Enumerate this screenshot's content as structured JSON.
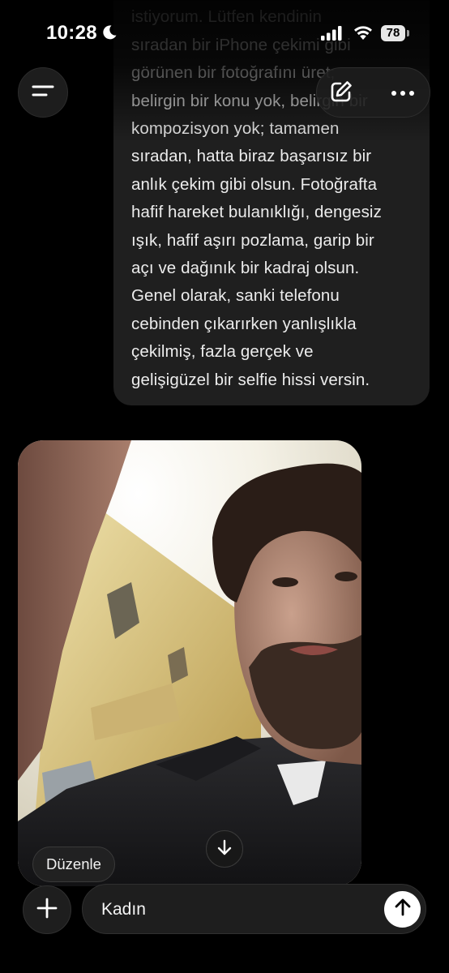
{
  "status_bar": {
    "time": "10:28",
    "battery": "78",
    "icons": [
      "moon-icon",
      "signal-icon",
      "wifi-icon",
      "battery-icon"
    ]
  },
  "header": {
    "menu_icon": "hamburger-menu-icon",
    "new_chat_icon": "compose-icon",
    "more_icon": "more-dots-icon"
  },
  "message": {
    "lines": [
      "istiyorum. Lütfen kendinin",
      "sıradan bir iPhone çekimi gibi",
      "görünen bir fotoğrafını üret;",
      "belirgin bir konu yok, belirgin bir",
      "kompozisyon yok; tamamen",
      "sıradan, hatta biraz başarısız bir",
      "anlık çekim gibi olsun. Fotoğrafta",
      "hafif hareket bulanıklığı, dengesiz",
      "ışık, hafif aşırı pozlama, garip bir",
      "açı ve dağınık bir kadraj olsun.",
      "Genel olarak, sanki telefonu",
      "cebinden çıkarırken yanlışlıkla",
      "çekilmiş, fazla gerçek ve",
      "gelişigüzel bir selfie hissi versin."
    ]
  },
  "image": {
    "edit_label": "Düzenle",
    "scroll_icon": "arrow-down-icon"
  },
  "composer": {
    "input_value": "Kadın",
    "plus_icon": "plus-icon",
    "send_icon": "arrow-up-icon"
  },
  "colors": {
    "background": "#000000",
    "bubble": "#1f1f1f",
    "text": "#ececec",
    "send_button": "#ffffff"
  }
}
